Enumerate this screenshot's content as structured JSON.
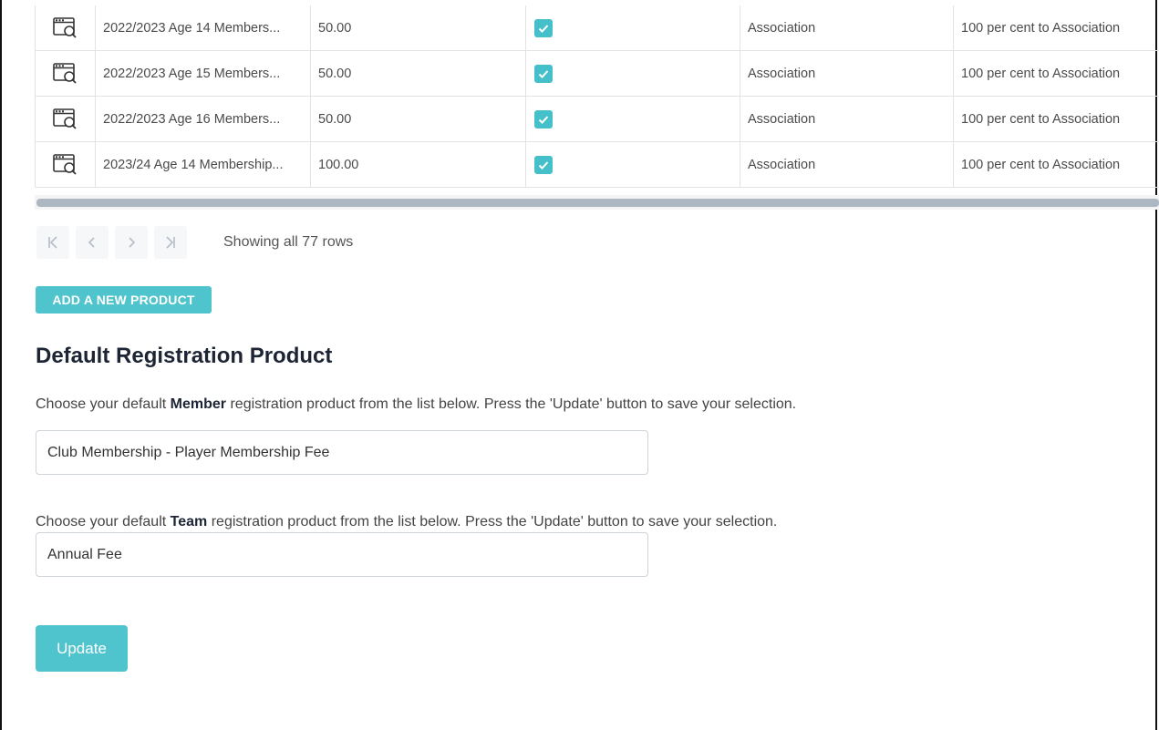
{
  "products_table": {
    "rows": [
      {
        "name": "2022/2023 Age 14 Members...",
        "price": "50.00",
        "checked": true,
        "owner": "Association",
        "split": "100 per cent to Association"
      },
      {
        "name": "2022/2023 Age 15 Members...",
        "price": "50.00",
        "checked": true,
        "owner": "Association",
        "split": "100 per cent to Association"
      },
      {
        "name": "2022/2023 Age 16 Members...",
        "price": "50.00",
        "checked": true,
        "owner": "Association",
        "split": "100 per cent to Association"
      },
      {
        "name": "2023/24 Age 14 Membership...",
        "price": "100.00",
        "checked": true,
        "owner": "Association",
        "split": "100 per cent to Association"
      }
    ]
  },
  "pagination": {
    "first_icon": "first-page-icon",
    "prev_icon": "prev-page-icon",
    "next_icon": "next-page-icon",
    "last_icon": "last-page-icon",
    "status": "Showing all 77 rows"
  },
  "add_product_label": "ADD A NEW PRODUCT",
  "default_section": {
    "title": "Default Registration Product",
    "member_instr_pre": "Choose your default ",
    "member_instr_bold": "Member",
    "member_instr_post": " registration product from the list below. Press the 'Update' button to save your selection.",
    "member_selected": "Club Membership - Player Membership Fee",
    "team_instr_pre": "Choose your default ",
    "team_instr_bold": "Team",
    "team_instr_post": " registration product from the list below. Press the 'Update' button to save your selection.",
    "team_selected": "Annual Fee",
    "update_label": "Update"
  },
  "colors": {
    "accent": "#4fc4cd",
    "checkbox": "#45c0ca",
    "heading": "#1d2535"
  }
}
